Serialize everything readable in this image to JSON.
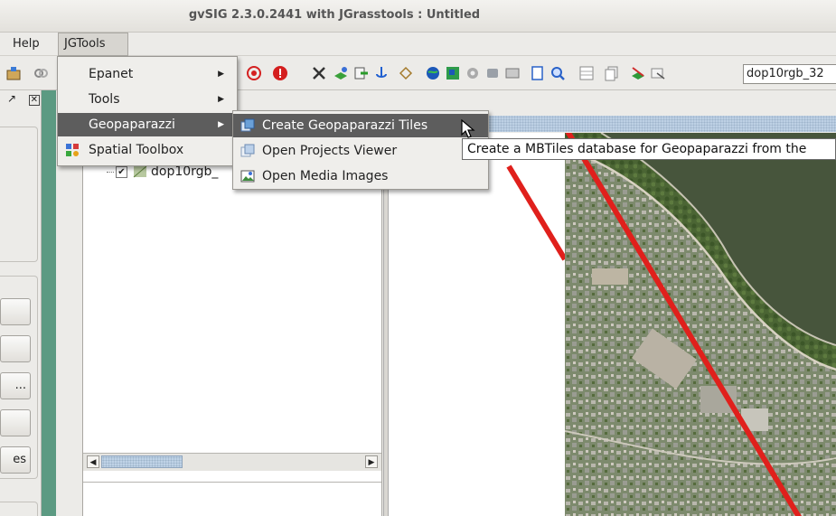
{
  "window": {
    "title": "gvSIG 2.3.0.2441 with JGrasstools : Untitled"
  },
  "menubar": {
    "help": "Help",
    "jgtools": "JGTools"
  },
  "toolbar": {
    "layer_combo_value": "dop10rgb_32"
  },
  "jgtools_menu": {
    "items": [
      {
        "label": "Epanet",
        "has_submenu": true
      },
      {
        "label": "Tools",
        "has_submenu": true
      },
      {
        "label": "Geopaparazzi",
        "has_submenu": true,
        "highlighted": true
      },
      {
        "label": "Spatial Toolbox",
        "has_submenu": false
      }
    ]
  },
  "geopaparazzi_menu": {
    "items": [
      {
        "label": "Create Geopaparazzi Tiles",
        "highlighted": true
      },
      {
        "label": "Open Projects Viewer"
      },
      {
        "label": "Open Media Images"
      }
    ]
  },
  "tooltip": {
    "text": "Create a MBTiles database for Geopaparazzi from the"
  },
  "toc": {
    "layer_name": "dop10rgb_"
  },
  "side_buttons": [
    "",
    "",
    "...",
    "",
    "es"
  ],
  "colors": {
    "highlight": "#5d5d5d",
    "desktop": "#5c9a82",
    "red_line": "#e0201c"
  }
}
